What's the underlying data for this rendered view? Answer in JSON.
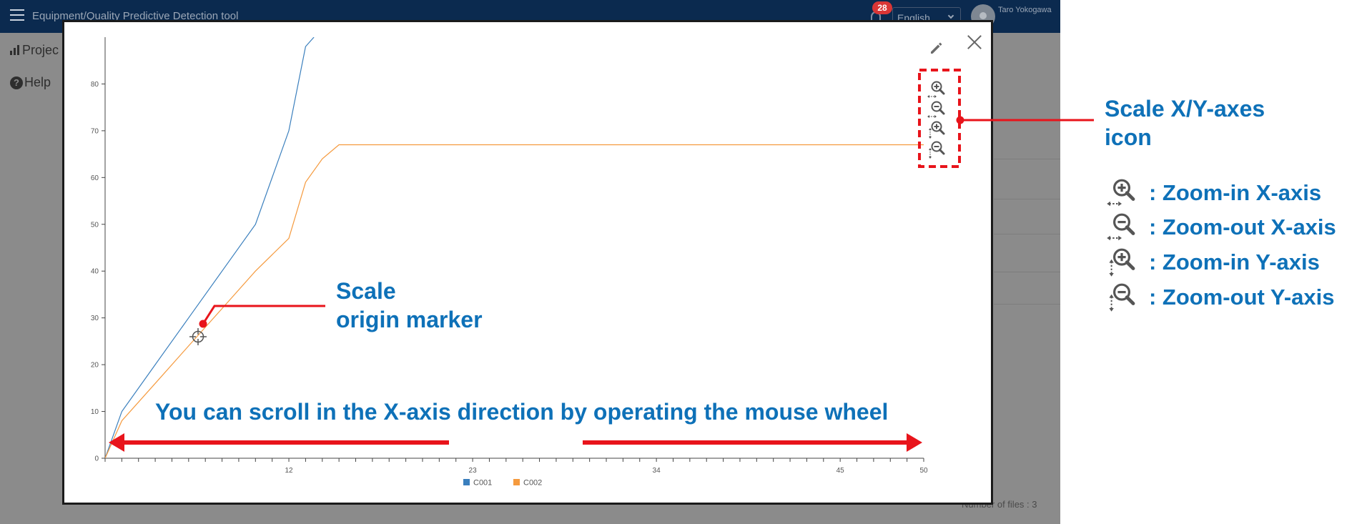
{
  "app": {
    "title": "Equipment/Quality Predictive Detection tool",
    "notification_count": "28",
    "language": "English",
    "user_name": "Taro Yokogawa",
    "sidebar": [
      {
        "label": "Projec"
      },
      {
        "label": "Help"
      }
    ],
    "files_count": "Number of files : 3"
  },
  "chart_data": {
    "type": "line",
    "x_ticks": [
      12,
      23,
      34,
      45,
      50
    ],
    "y_ticks": [
      0,
      10,
      20,
      30,
      40,
      50,
      60,
      70,
      80
    ],
    "xlim": [
      1,
      50
    ],
    "ylim": [
      0,
      90
    ],
    "series": [
      {
        "name": "C001",
        "color": "#3a7fbd",
        "x": [
          1,
          2,
          4,
          6,
          8,
          10,
          12,
          13,
          13.5
        ],
        "y": [
          0,
          10,
          20,
          30,
          40,
          50,
          70,
          88,
          90
        ]
      },
      {
        "name": "C002",
        "color": "#f59a3e",
        "x": [
          1,
          2,
          4,
          6,
          8,
          10,
          12,
          13,
          14,
          15,
          50
        ],
        "y": [
          0,
          8,
          16,
          24,
          32,
          40,
          47,
          59,
          64,
          67,
          67
        ]
      }
    ],
    "legend_position": "bottom-center"
  },
  "annotations": {
    "scroll_text": "You can scroll in the X-axis direction by operating the mouse wheel",
    "origin_label_line1": "Scale",
    "origin_label_line2": "origin marker",
    "axes_label_line1": "Scale X/Y-axes",
    "axes_label_line2": "icon",
    "legend": [
      {
        "icon": "zoom-in-x-icon",
        "text": ": Zoom-in X-axis"
      },
      {
        "icon": "zoom-out-x-icon",
        "text": ": Zoom-out X-axis"
      },
      {
        "icon": "zoom-in-y-icon",
        "text": ": Zoom-in Y-axis"
      },
      {
        "icon": "zoom-out-y-icon",
        "text": ": Zoom-out Y-axis"
      }
    ],
    "highlight_color": "#e8141b",
    "text_color": "#0e71b8"
  }
}
